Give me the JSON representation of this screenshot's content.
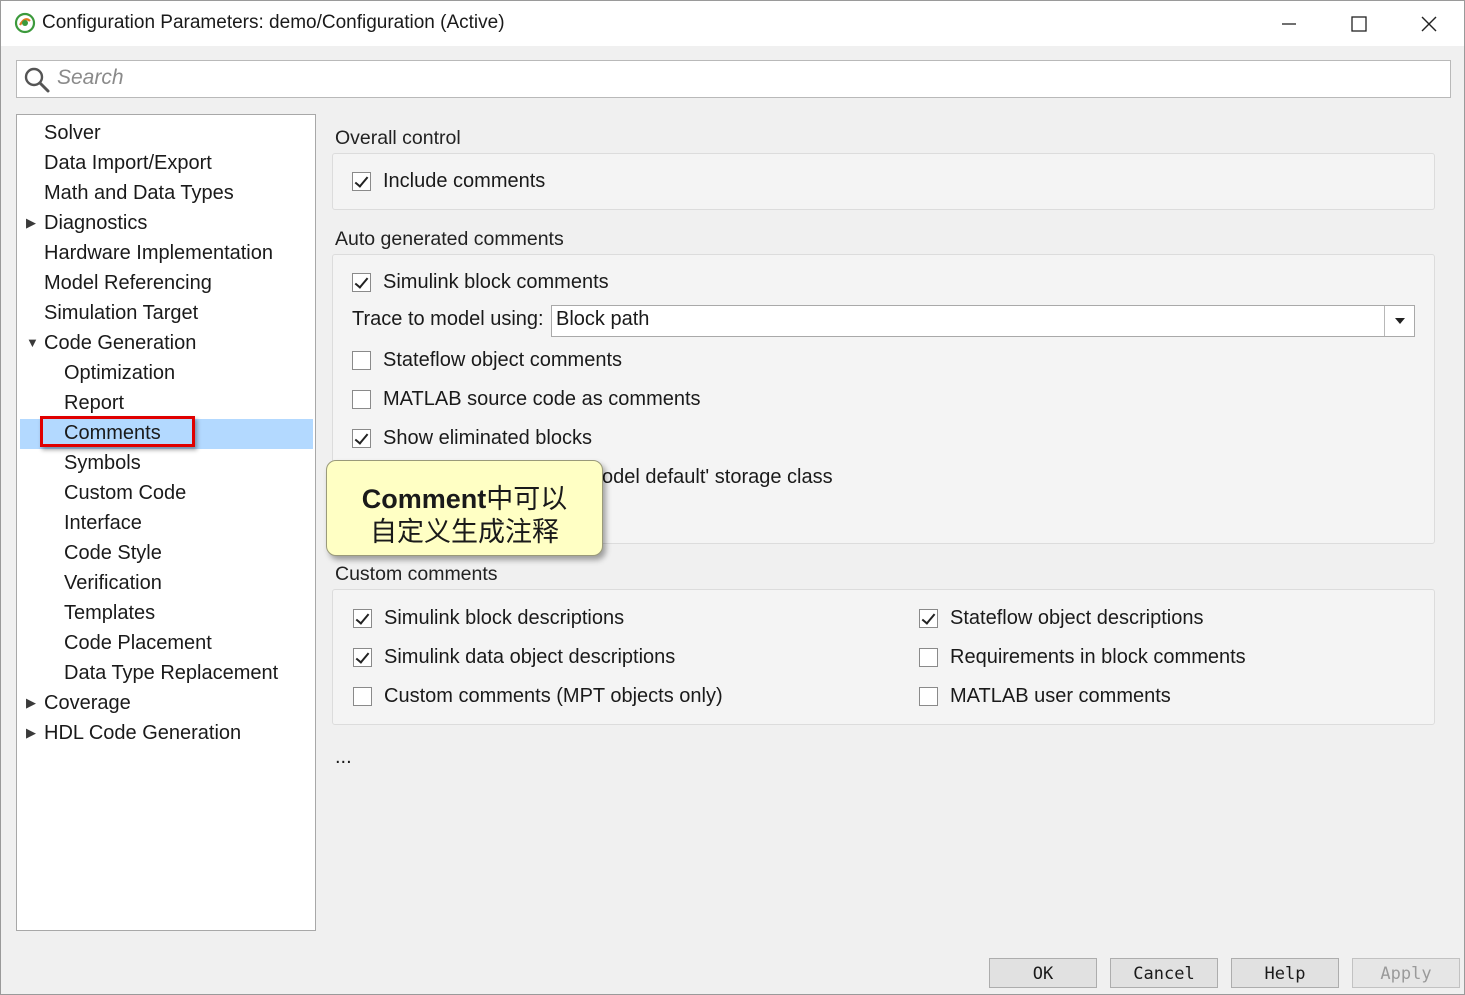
{
  "window": {
    "title": "Configuration Parameters: demo/Configuration (Active)",
    "controls": [
      "minimize-icon",
      "maximize-icon",
      "close-icon"
    ]
  },
  "search": {
    "placeholder": "Search"
  },
  "tree": {
    "items": [
      {
        "label": "Solver",
        "level": 0,
        "expander": "none"
      },
      {
        "label": "Data Import/Export",
        "level": 0,
        "expander": "none"
      },
      {
        "label": "Math and Data Types",
        "level": 0,
        "expander": "none"
      },
      {
        "label": "Diagnostics",
        "level": 0,
        "expander": "collapsed"
      },
      {
        "label": "Hardware Implementation",
        "level": 0,
        "expander": "none"
      },
      {
        "label": "Model Referencing",
        "level": 0,
        "expander": "none"
      },
      {
        "label": "Simulation Target",
        "level": 0,
        "expander": "none"
      },
      {
        "label": "Code Generation",
        "level": 0,
        "expander": "expanded"
      },
      {
        "label": "Optimization",
        "level": 1,
        "expander": "none"
      },
      {
        "label": "Report",
        "level": 1,
        "expander": "none"
      },
      {
        "label": "Comments",
        "level": 1,
        "expander": "none",
        "selected": true
      },
      {
        "label": "Symbols",
        "level": 1,
        "expander": "none"
      },
      {
        "label": "Custom Code",
        "level": 1,
        "expander": "none"
      },
      {
        "label": "Interface",
        "level": 1,
        "expander": "none"
      },
      {
        "label": "Code Style",
        "level": 1,
        "expander": "none"
      },
      {
        "label": "Verification",
        "level": 1,
        "expander": "none"
      },
      {
        "label": "Templates",
        "level": 1,
        "expander": "none"
      },
      {
        "label": "Code Placement",
        "level": 1,
        "expander": "none"
      },
      {
        "label": "Data Type Replacement",
        "level": 1,
        "expander": "none"
      },
      {
        "label": "Coverage",
        "level": 0,
        "expander": "collapsed"
      },
      {
        "label": "HDL Code Generation",
        "level": 0,
        "expander": "collapsed"
      }
    ]
  },
  "overall": {
    "title": "Overall control",
    "include_comments": {
      "label": "Include comments",
      "checked": true
    }
  },
  "auto": {
    "title": "Auto generated comments",
    "simulink_block_comments": {
      "label": "Simulink block comments",
      "checked": true
    },
    "trace_label": "Trace to model using:",
    "trace_value": "Block path",
    "stateflow_object_comments": {
      "label": "Stateflow object comments",
      "checked": false
    },
    "matlab_source_code": {
      "label": "MATLAB source code as comments",
      "checked": false
    },
    "show_eliminated_blocks": {
      "label": "Show eliminated blocks",
      "checked": true
    },
    "model_default_partial": "odel default' storage class"
  },
  "custom": {
    "title": "Custom comments",
    "simulink_block_descriptions": {
      "label": "Simulink block descriptions",
      "checked": true
    },
    "simulink_data_object_descriptions": {
      "label": "Simulink data object descriptions",
      "checked": true
    },
    "custom_comments_mpt": {
      "label": "Custom comments (MPT objects only)",
      "checked": false
    },
    "stateflow_object_descriptions": {
      "label": "Stateflow object descriptions",
      "checked": true
    },
    "requirements_in_block_comments": {
      "label": "Requirements in block comments",
      "checked": false
    },
    "matlab_user_comments": {
      "label": "MATLAB user comments",
      "checked": false
    }
  },
  "ellipsis": "...",
  "callout": {
    "line1_bold": "Comment",
    "line1_rest": "中可以",
    "line2": "自定义生成注释"
  },
  "footer": {
    "ok": "OK",
    "cancel": "Cancel",
    "help": "Help",
    "apply": "Apply"
  },
  "colors": {
    "selection_highlight": "#b3d9ff",
    "annotation_red": "#e00000",
    "callout_fill": "#ffffc4"
  }
}
